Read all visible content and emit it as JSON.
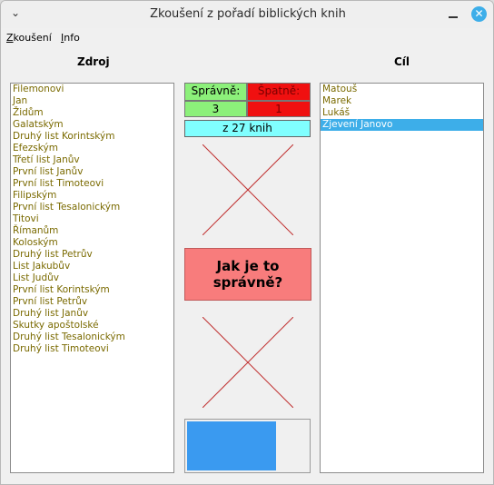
{
  "window": {
    "title": "Zkoušení z pořadí biblických knih"
  },
  "menu": {
    "items": [
      "Zkoušení",
      "Info"
    ]
  },
  "source": {
    "label": "Zdroj",
    "items": [
      "Filemonovi",
      "Jan",
      "Židům",
      "Galatským",
      "Druhý list Korintským",
      "Efezským",
      "Třetí list Janův",
      "První list Janův",
      "První list Timoteovi",
      "Filipským",
      "První list Tesalonickým",
      "Titovi",
      "Římanům",
      "Koloským",
      "Druhý list Petrův",
      "List Jakubův",
      "List Judův",
      "První list Korintským",
      "První list Petrův",
      "Druhý list Janův",
      "Skutky apoštolské",
      "Druhý list Tesalonickým",
      "Druhý list Timoteovi"
    ]
  },
  "target": {
    "label": "Cíl",
    "items": [
      "Matouš",
      "Marek",
      "Lukáš",
      "Zjevení Janovo"
    ],
    "selected_index": 3
  },
  "score": {
    "correct_label": "Správně:",
    "wrong_label": "Špatně:",
    "correct_value": "3",
    "wrong_value": "1",
    "total": "z 27 knih"
  },
  "answer_button": {
    "line1": "Jak je to",
    "line2": "správně?"
  },
  "progress": {
    "fraction": 0.74
  },
  "colors": {
    "accent": "#3daee9",
    "correct": "#8cf07a",
    "wrong": "#f01010",
    "total": "#80ffff",
    "button": "#f87c7c",
    "cross": "#c03030"
  }
}
